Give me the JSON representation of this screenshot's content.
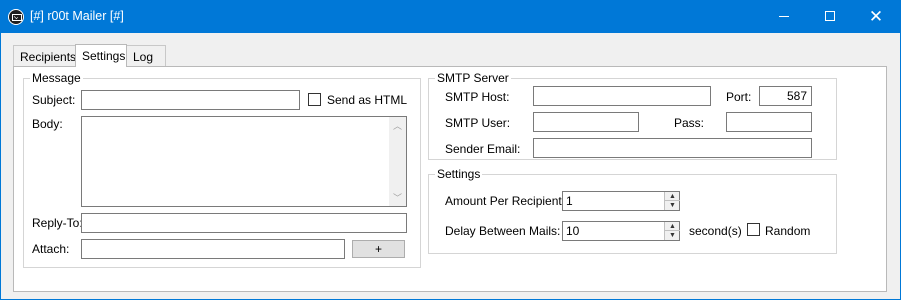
{
  "window": {
    "title": "[#] r00t Mailer [#]",
    "icon": "mail-icon",
    "minimize": "—",
    "close": "✕"
  },
  "tabs": [
    "Recipients",
    "Settings",
    "Log"
  ],
  "active_tab": "Settings",
  "message": {
    "group_label": "Message",
    "subject_label": "Subject:",
    "subject_value": "",
    "send_html_label": "Send as HTML",
    "send_html_checked": false,
    "body_label": "Body:",
    "body_value": "",
    "reply_to_label": "Reply-To:",
    "reply_to_value": "",
    "attach_label": "Attach:",
    "attach_value": "",
    "attach_button": "+"
  },
  "smtp": {
    "group_label": "SMTP Server",
    "host_label": "SMTP Host:",
    "host_value": "",
    "port_label": "Port:",
    "port_value": "587",
    "user_label": "SMTP User:",
    "user_value": "",
    "pass_label": "Pass:",
    "pass_value": "",
    "sender_label": "Sender Email:",
    "sender_value": ""
  },
  "settings": {
    "group_label": "Settings",
    "amount_label": "Amount Per Recipient:",
    "amount_value": "1",
    "delay_label": "Delay Between Mails:",
    "delay_value": "10",
    "delay_unit": "second(s)",
    "random_label": "Random",
    "random_checked": false
  },
  "colors": {
    "titlebar": "#0078d7",
    "window_bg": "#f0f0f0",
    "panel_bg": "#ffffff"
  }
}
